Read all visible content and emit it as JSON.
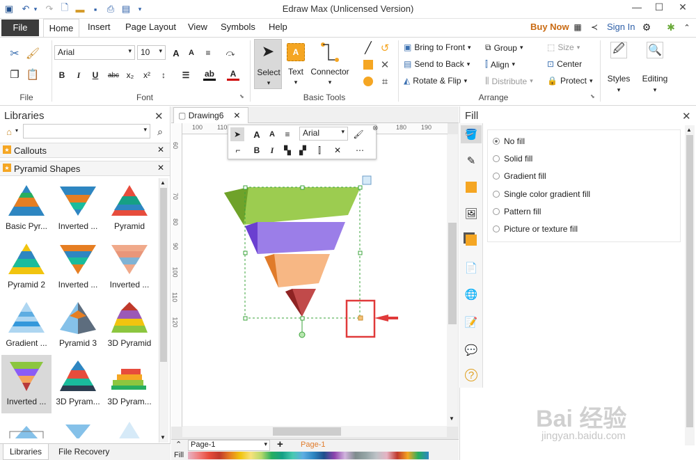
{
  "window": {
    "title": "Edraw Max (Unlicensed Version)",
    "minimize": "—",
    "maximize": "☐",
    "close": "✕"
  },
  "tabs": {
    "file": "File",
    "home": "Home",
    "insert": "Insert",
    "page_layout": "Page Layout",
    "view": "View",
    "symbols": "Symbols",
    "help": "Help",
    "buy_now": "Buy Now",
    "sign_in": "Sign In"
  },
  "ribbon": {
    "file_group": "File",
    "font_group": "Font",
    "basic_tools_group": "Basic Tools",
    "arrange_group": "Arrange",
    "font_name": "Arial",
    "font_size": "10",
    "select": "Select",
    "text": "Text",
    "connector": "Connector",
    "bring_to_front": "Bring to Front",
    "send_to_back": "Send to Back",
    "rotate_flip": "Rotate & Flip",
    "group": "Group",
    "align": "Align",
    "distribute": "Distribute",
    "size": "Size",
    "center": "Center",
    "protect": "Protect",
    "styles": "Styles",
    "editing": "Editing",
    "bold": "B",
    "italic": "I",
    "underline": "U",
    "strike": "abc",
    "subscript": "x₂",
    "superscript": "x²",
    "grow_font": "A",
    "shrink_font": "A"
  },
  "libraries": {
    "title": "Libraries",
    "sections": [
      "Callouts",
      "Pyramid Shapes"
    ],
    "shapes": [
      "Basic Pyr...",
      "Inverted ...",
      "Pyramid",
      "Pyramid 2",
      "Inverted ...",
      "Inverted ...",
      "Gradient ...",
      "Pyramid 3",
      "3D Pyramid",
      "Inverted ...",
      "3D Pyram...",
      "3D Pyram..."
    ],
    "bottom_tabs": [
      "Libraries",
      "File Recovery"
    ]
  },
  "document": {
    "tab": "Drawing6",
    "ruler_top": [
      "100",
      "110",
      "180",
      "190"
    ],
    "ruler_left": [
      "60",
      "70",
      "80",
      "90",
      "100",
      "110",
      "120"
    ],
    "mini_font": "Arial",
    "page_selector": "Page-1",
    "active_page": "Page-1",
    "fill_label": "Fill"
  },
  "fill_panel": {
    "title": "Fill",
    "options": [
      "No fill",
      "Solid fill",
      "Gradient fill",
      "Single color gradient fill",
      "Pattern fill",
      "Picture or texture fill"
    ],
    "selected": "No fill"
  },
  "colors": {
    "accent": "#c0392b",
    "buy_now": "#c96a12",
    "sign_in": "#2d5fa8",
    "file_tab": "#3c3c3c",
    "pyramid_green": "#8cc63f",
    "pyramid_purple": "#8b5cf6",
    "pyramid_orange": "#f5a35b",
    "pyramid_red": "#b83a3a"
  },
  "watermark": {
    "text": "Bai 经验",
    "url": "jingyan.baidu.com"
  }
}
